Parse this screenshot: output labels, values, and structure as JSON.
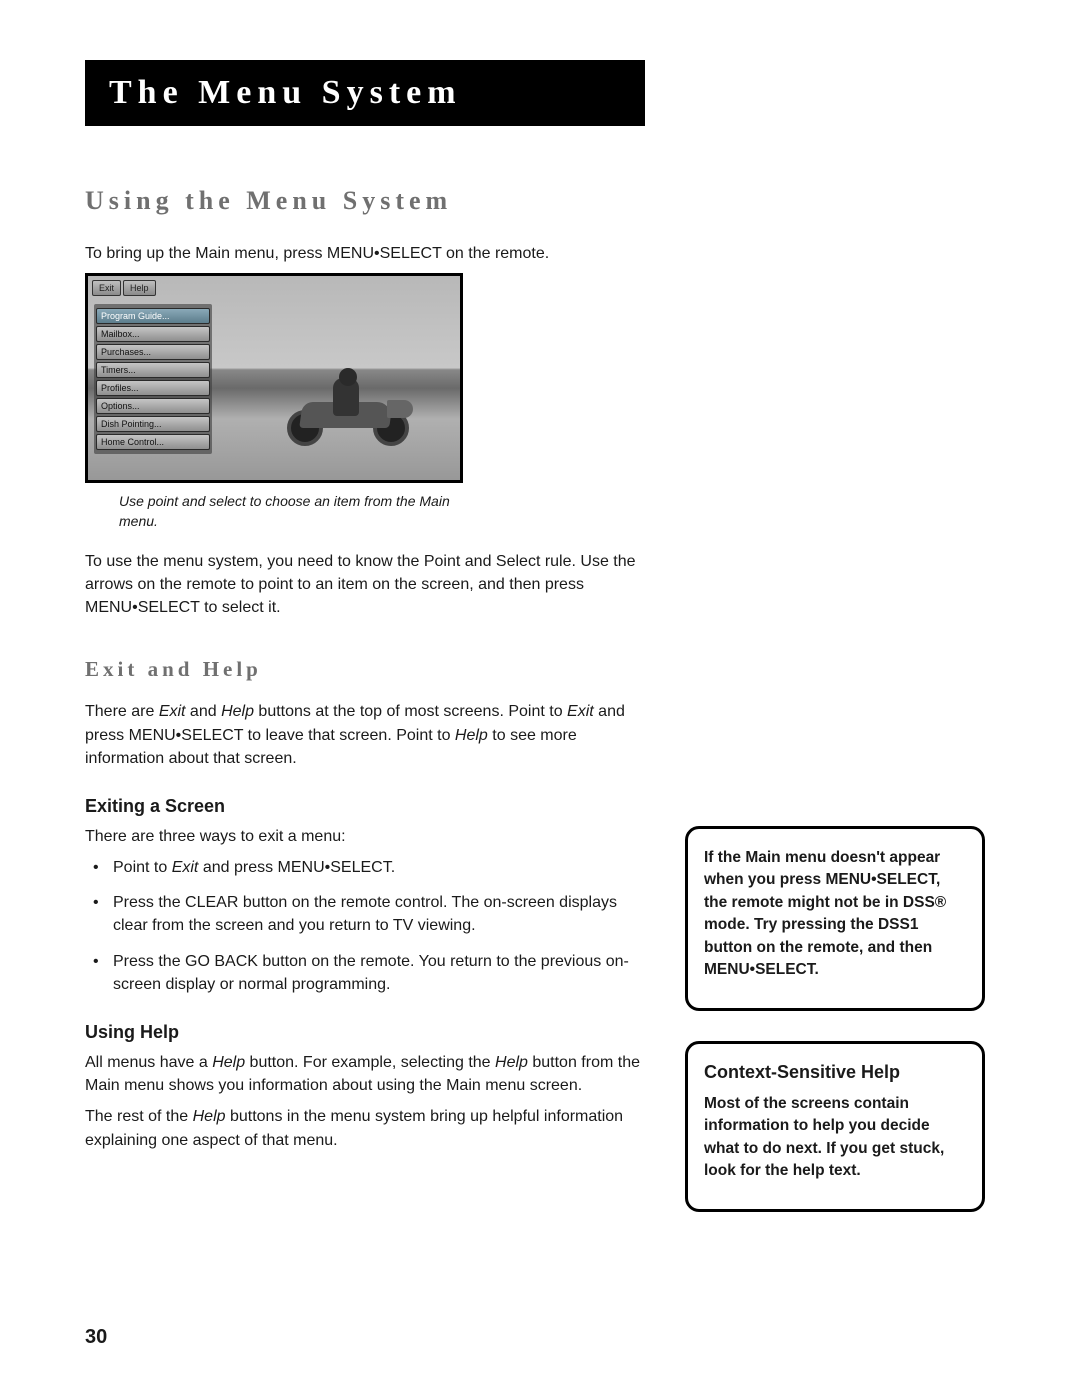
{
  "title": "The Menu System",
  "section1": {
    "heading": "Using the Menu System",
    "p1": "To bring up the Main menu, press MENU•SELECT on the remote.",
    "caption": "Use point and select to choose an item from the Main menu.",
    "p2": "To use the menu system, you need to know the Point and Select rule. Use the arrows on the remote to point to an item on the screen, and then press MENU•SELECT to select it."
  },
  "screenshot": {
    "tabs": {
      "exit": "Exit",
      "help": "Help"
    },
    "menu": {
      "program_guide": "Program Guide...",
      "mailbox": "Mailbox...",
      "purchases": "Purchases...",
      "timers": "Timers...",
      "profiles": "Profiles...",
      "options": "Options...",
      "dish_pointing": "Dish Pointing...",
      "home_control": "Home Control..."
    }
  },
  "section2": {
    "heading": "Exit and Help",
    "p_pre": "There are ",
    "i_exit": "Exit",
    "p_mid1": " and ",
    "i_help": "Help",
    "p_mid2": " buttons at the top of most screens. Point to ",
    "i_exit2": "Exit",
    "p_mid3": " and press MENU•SELECT to leave that screen. Point to ",
    "i_help2": "Help",
    "p_end": " to see more information about that screen."
  },
  "section3": {
    "heading": "Exiting a Screen",
    "intro": "There are three ways to exit a menu:",
    "b1_pre": "Point to ",
    "b1_i": "Exit",
    "b1_post": " and press MENU•SELECT.",
    "b2": "Press the CLEAR button on the remote control. The on-screen displays clear from the screen and you return to TV viewing.",
    "b3": "Press the GO BACK button on the remote. You return to the previous on-screen display or normal programming."
  },
  "section4": {
    "heading": "Using Help",
    "p1_pre": "All menus have a ",
    "p1_i1": "Help",
    "p1_mid": " button. For example, selecting the ",
    "p1_i2": "Help",
    "p1_post": " button from the Main menu shows you information about using the Main menu screen.",
    "p2_pre": "The rest of the ",
    "p2_i": "Help",
    "p2_post": " buttons in the menu system bring up helpful information explaining one aspect of that menu."
  },
  "sidebox1": {
    "text": "If the Main menu doesn't appear when you press MENU•SELECT, the remote might not be in DSS® mode. Try pressing the DSS1 button on the remote, and then MENU•SELECT."
  },
  "sidebox2": {
    "heading": "Context-Sensitive Help",
    "text": "Most of the screens contain information to help you decide what to do next. If you get stuck, look for the help text."
  },
  "pagenum": "30"
}
